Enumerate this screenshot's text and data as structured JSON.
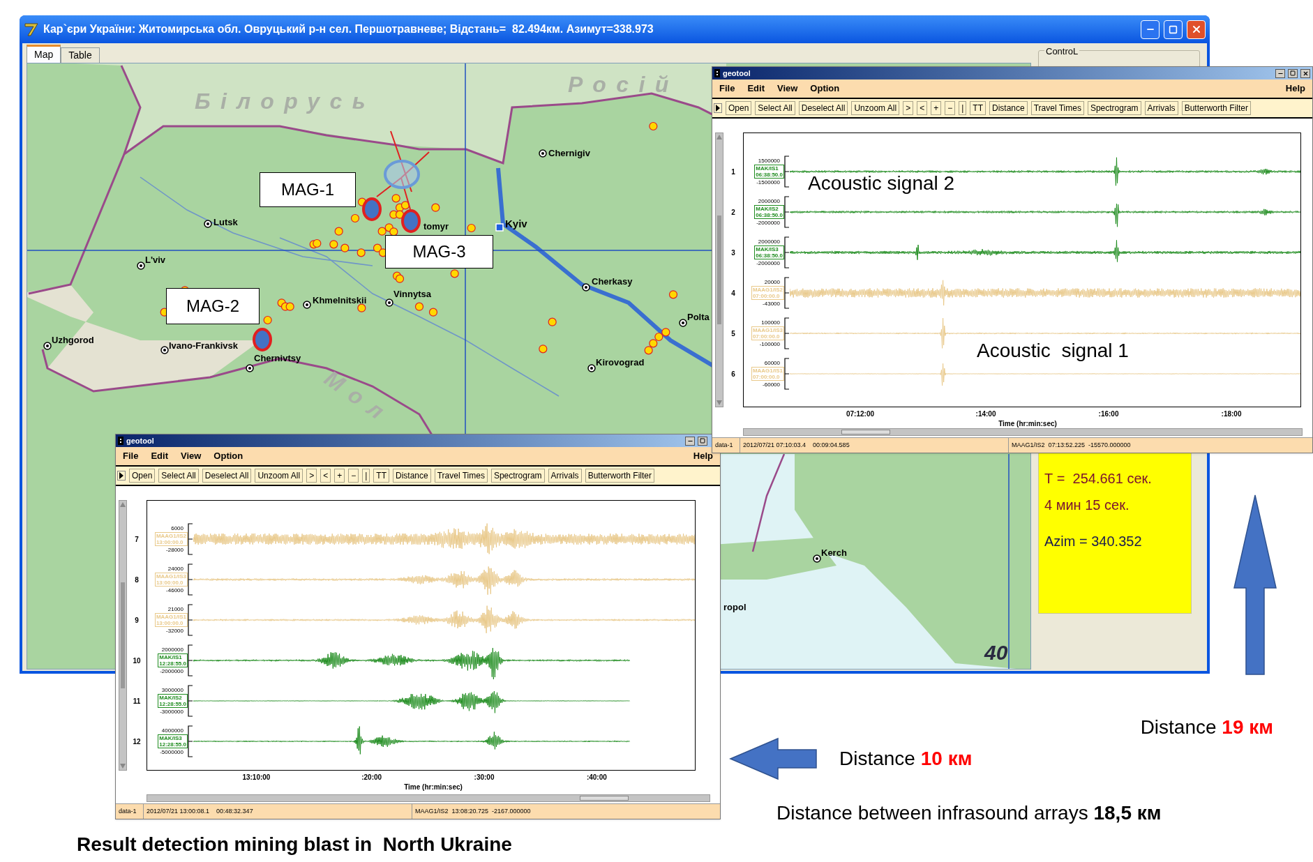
{
  "main_window": {
    "title": "Кар`єри України: Житомирська обл. Овруцький р-н сел. Першотравневе; Відстань=  82.494км. Азимут=338.973",
    "tabs": [
      {
        "label": "Map",
        "selected": true
      },
      {
        "label": "Table",
        "selected": false
      }
    ],
    "control_group": "ControL",
    "map": {
      "labels": [
        {
          "text": "Білорусь",
          "kind": "country"
        },
        {
          "text": "Росій",
          "kind": "country"
        },
        {
          "text": "Chernigiv",
          "kind": "city"
        },
        {
          "text": "Lutsk",
          "kind": "city"
        },
        {
          "text": "tomyr",
          "kind": "label"
        },
        {
          "text": "Kyiv",
          "kind": "capital"
        },
        {
          "text": "L'viv",
          "kind": "city"
        },
        {
          "text": "Khmelnitskii",
          "kind": "city"
        },
        {
          "text": "Vinnytsa",
          "kind": "city"
        },
        {
          "text": "Cherkasy",
          "kind": "city"
        },
        {
          "text": "Polta",
          "kind": "city"
        },
        {
          "text": "Uzhgorod",
          "kind": "city"
        },
        {
          "text": "Ivano-Frankivsk",
          "kind": "city"
        },
        {
          "text": "Chernivtsy",
          "kind": "city"
        },
        {
          "text": "Kirovograd",
          "kind": "city"
        },
        {
          "text": "Мол",
          "kind": "country"
        },
        {
          "text": "Kerch",
          "kind": "city"
        },
        {
          "text": "ropol",
          "kind": "label"
        },
        {
          "text": "40",
          "kind": "number"
        }
      ]
    },
    "info_box": {
      "lines": [
        {
          "text": "Т =  254.661 сек.",
          "color": "#7a1030"
        },
        {
          "text": "4 мин 15 сек.",
          "color": "#7a1030"
        },
        {
          "text": "Azim = 340.352",
          "color": "#1a1a50"
        }
      ]
    }
  },
  "geotool_windows": [
    {
      "title": "geotool",
      "menus": [
        "File",
        "Edit",
        "View",
        "Option"
      ],
      "help": "Help",
      "toolbar": [
        "Open",
        "Select All",
        "Deselect All",
        "Unzoom All",
        ">",
        "<",
        "+",
        "−",
        "|",
        "TT",
        "Distance",
        "Travel Times",
        "Spectrogram",
        "Arrivals",
        "Butterworth Filter"
      ],
      "traces": [
        {
          "number": "1",
          "station": "MAK/IS1",
          "start": "06:38:50.0",
          "max": "1500000",
          "min": "-1500000",
          "color": "#1e8c1e"
        },
        {
          "number": "2",
          "station": "MAK/IS2",
          "start": "06:38:50.0",
          "max": "2000000",
          "min": "-2000000",
          "color": "#1e8c1e"
        },
        {
          "number": "3",
          "station": "MAK/IS3",
          "start": "06:38:50.0",
          "max": "2000000",
          "min": "-2000000",
          "color": "#1e8c1e"
        },
        {
          "number": "4",
          "station": "MAAG1/IS2",
          "start": "07:00:00.0",
          "max": "20000",
          "min": "-43000",
          "color": "#e9c98a"
        },
        {
          "number": "5",
          "station": "MAAG1/IS3",
          "start": "07:00:00.0",
          "max": "100000",
          "min": "-100000",
          "color": "#e9c98a"
        },
        {
          "number": "6",
          "station": "MAAG1/IS1",
          "start": "07:00:00.0",
          "max": "60000",
          "min": "-60000",
          "color": "#e9c98a"
        }
      ],
      "xticks": [
        "07:12:00",
        ":14:00",
        ":16:00",
        ":18:00"
      ],
      "xlabel": "Time (hr:min:sec)",
      "status": [
        "data-1",
        "2012/07/21 07:10:03.4    00:09:04.585",
        "MAAG1/IS2  07:13:52.225  -15570.000000"
      ]
    },
    {
      "title": "geotool",
      "menus": [
        "File",
        "Edit",
        "View",
        "Option"
      ],
      "help": "Help",
      "toolbar": [
        "Open",
        "Select All",
        "Deselect All",
        "Unzoom All",
        ">",
        "<",
        "+",
        "−",
        "|",
        "TT",
        "Distance",
        "Travel Times",
        "Spectrogram",
        "Arrivals",
        "Butterworth Filter"
      ],
      "traces": [
        {
          "number": "7",
          "station": "MAAG1/IS2",
          "start": "13:00:00.0",
          "max": "6000",
          "min": "-28000",
          "color": "#e9c98a"
        },
        {
          "number": "8",
          "station": "MAAG1/IS3",
          "start": "13:00:00.0",
          "max": "24000",
          "min": "-46000",
          "color": "#e9c98a"
        },
        {
          "number": "9",
          "station": "MAAG1/IS1",
          "start": "13:00:00.0",
          "max": "21000",
          "min": "-32000",
          "color": "#e9c98a"
        },
        {
          "number": "10",
          "station": "MAK/IS1",
          "start": "12:28:55.0",
          "max": "2000000",
          "min": "-2000000",
          "color": "#1e8c1e"
        },
        {
          "number": "11",
          "station": "MAK/IS2",
          "start": "12:28:55.0",
          "max": "3000000",
          "min": "-3000000",
          "color": "#1e8c1e"
        },
        {
          "number": "12",
          "station": "MAK/IS3",
          "start": "12:28:55.0",
          "max": "4000000",
          "min": "-5000000",
          "color": "#1e8c1e"
        }
      ],
      "xticks": [
        "13:10:00",
        ":20:00",
        ":30:00",
        ":40:00"
      ],
      "xlabel": "Time (hr:min:sec)",
      "status": [
        "data-1",
        "2012/07/21 13:00:08.1    00:48:32.347",
        "MAAG1/IS2  13:08:20.725  -2167.000000"
      ]
    }
  ],
  "annotations": {
    "callouts": [
      "MAG-1",
      "MAG-3",
      "MAG-2"
    ],
    "signal_labels": [
      "Acoustic signal 2",
      "Acoustic  signal 1"
    ]
  },
  "notes": [
    {
      "prefix": "Distance",
      "value": "19 км",
      "color": "#ff0000"
    },
    {
      "prefix": "Distance",
      "value": "10 км",
      "color": "#ff0000"
    },
    {
      "prefix": "Distance between infrasound arrays",
      "value": "18,5 км",
      "color": "#000000"
    }
  ],
  "caption": "Result detection mining blast in  North Ukraine"
}
